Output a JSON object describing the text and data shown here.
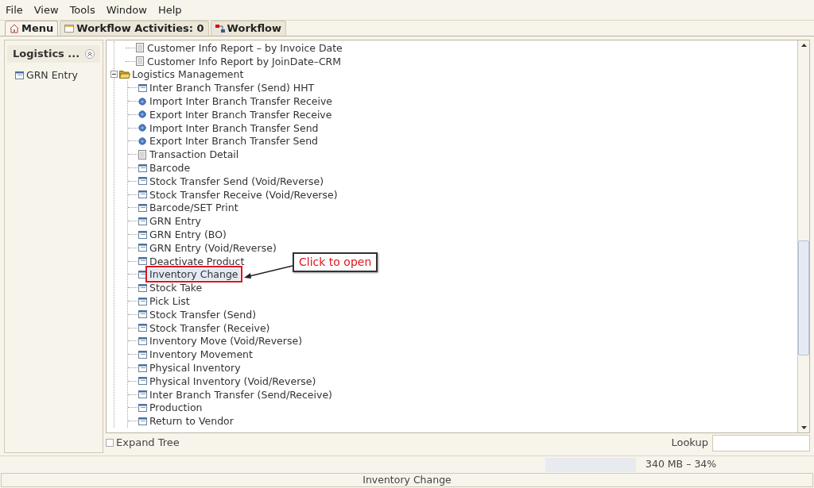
{
  "menu_bar": [
    "File",
    "View",
    "Tools",
    "Window",
    "Help"
  ],
  "tabs": [
    {
      "label": "Menu",
      "kind": "home",
      "selected": true
    },
    {
      "label": "Workflow Activities: 0",
      "kind": "list",
      "selected": false
    },
    {
      "label": "Workflow",
      "kind": "flow",
      "selected": false
    }
  ],
  "left_panel": {
    "title": "Logistics ...",
    "items": [
      "GRN Entry"
    ]
  },
  "tree": {
    "scrolled_group": {
      "children": [
        {
          "label": "Customer Info Report – by Invoice Date",
          "kind": "report",
          "selected": false,
          "highlighted": false
        },
        {
          "label": "Customer Info Report by JoinDate–CRM",
          "kind": "report",
          "selected": false,
          "highlighted": false
        }
      ]
    },
    "nodes": [
      {
        "label": "Logistics Management",
        "kind": "folder",
        "expanded": true,
        "children": [
          {
            "label": "Inter Branch Transfer (Send) HHT",
            "kind": "form",
            "selected": false,
            "highlighted": false
          },
          {
            "label": "Import Inter Branch Transfer Receive",
            "kind": "process",
            "selected": false,
            "highlighted": false
          },
          {
            "label": "Export Inter Branch Transfer Receive",
            "kind": "process",
            "selected": false,
            "highlighted": false
          },
          {
            "label": "Import Inter Branch Transfer Send",
            "kind": "process",
            "selected": false,
            "highlighted": false
          },
          {
            "label": "Export Inter Branch Transfer Send",
            "kind": "process",
            "selected": false,
            "highlighted": false
          },
          {
            "label": "Transaction Detail",
            "kind": "report",
            "selected": false,
            "highlighted": false
          },
          {
            "label": "Barcode",
            "kind": "form",
            "selected": false,
            "highlighted": false
          },
          {
            "label": "Stock Transfer Send (Void/Reverse)",
            "kind": "form",
            "selected": false,
            "highlighted": false
          },
          {
            "label": "Stock Transfer Receive (Void/Reverse)",
            "kind": "form",
            "selected": false,
            "highlighted": false
          },
          {
            "label": "Barcode/SET Print",
            "kind": "form",
            "selected": false,
            "highlighted": false
          },
          {
            "label": "GRN Entry",
            "kind": "form",
            "selected": false,
            "highlighted": false
          },
          {
            "label": "GRN Entry (BO)",
            "kind": "form",
            "selected": false,
            "highlighted": false
          },
          {
            "label": "GRN Entry (Void/Reverse)",
            "kind": "form",
            "selected": false,
            "highlighted": false
          },
          {
            "label": "Deactivate Product",
            "kind": "form",
            "selected": false,
            "highlighted": false
          },
          {
            "label": "Inventory Change",
            "kind": "form",
            "selected": true,
            "highlighted": true
          },
          {
            "label": "Stock Take",
            "kind": "form",
            "selected": false,
            "highlighted": false
          },
          {
            "label": "Pick List",
            "kind": "form",
            "selected": false,
            "highlighted": false
          },
          {
            "label": "Stock Transfer (Send)",
            "kind": "form",
            "selected": false,
            "highlighted": false
          },
          {
            "label": "Stock Transfer (Receive)",
            "kind": "form",
            "selected": false,
            "highlighted": false
          },
          {
            "label": "Inventory Move (Void/Reverse)",
            "kind": "form",
            "selected": false,
            "highlighted": false
          },
          {
            "label": "Inventory Movement",
            "kind": "form",
            "selected": false,
            "highlighted": false
          },
          {
            "label": "Physical Inventory",
            "kind": "form",
            "selected": false,
            "highlighted": false
          },
          {
            "label": "Physical Inventory (Void/Reverse)",
            "kind": "form",
            "selected": false,
            "highlighted": false
          },
          {
            "label": "Inter Branch Transfer (Send/Receive)",
            "kind": "form",
            "selected": false,
            "highlighted": false
          },
          {
            "label": "Production",
            "kind": "form",
            "selected": false,
            "highlighted": false
          },
          {
            "label": "Return to Vendor",
            "kind": "form",
            "selected": false,
            "highlighted": false
          }
        ]
      }
    ]
  },
  "callout": {
    "text": "Click to open"
  },
  "expand_tree": {
    "label": "Expand Tree",
    "checked": false
  },
  "lookup": {
    "label": "Lookup"
  },
  "memory": {
    "reading": "340 MB – 34%"
  },
  "status_bar": "Inventory Change"
}
